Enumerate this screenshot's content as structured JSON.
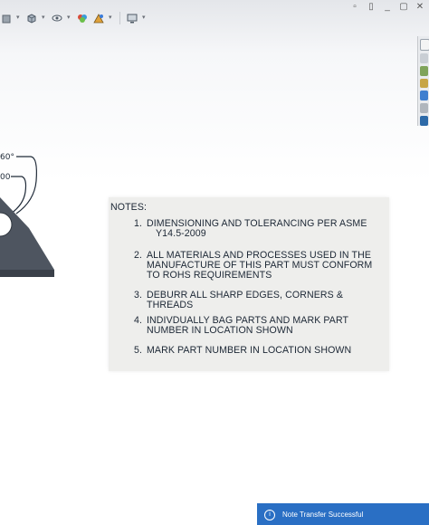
{
  "toolbar": {
    "icons": [
      "view-orientation-icon",
      "display-style-icon",
      "hide-show-icon",
      "appearance-icon",
      "scenes-icon",
      "monitor-icon"
    ]
  },
  "drawing": {
    "angle_label": "60°",
    "dim_label": "00"
  },
  "notes": {
    "title": "NOTES:",
    "items": [
      {
        "num": "1.",
        "line1": "DIMENSIONING AND TOLERANCING PER ASME",
        "line2": "Y14.5-2009",
        "line3": ""
      },
      {
        "num": "2.",
        "line1": "ALL MATERIALS AND PROCESSES USED IN THE",
        "line2": "MANUFACTURE OF THIS PART MUST CONFORM",
        "line3": "TO ROHS REQUIREMENTS"
      },
      {
        "num": "3.",
        "line1": "DEBURR ALL SHARP EDGES, CORNERS & THREADS",
        "line2": "",
        "line3": ""
      },
      {
        "num": "4.",
        "line1": "INDIVDUALLY BAG PARTS AND  MARK PART",
        "line2": "NUMBER IN LOCATION SHOWN",
        "line3": ""
      },
      {
        "num": "5.",
        "line1": "MARK PART NUMBER IN LOCATION SHOWN",
        "line2": "",
        "line3": ""
      }
    ]
  },
  "toast": {
    "title": "Note Transfer Successful"
  },
  "colors": {
    "accent": "#2a6fc4",
    "notes_bg": "#eeeeec",
    "part_fill": "#4e5560",
    "text": "#1c2735"
  }
}
